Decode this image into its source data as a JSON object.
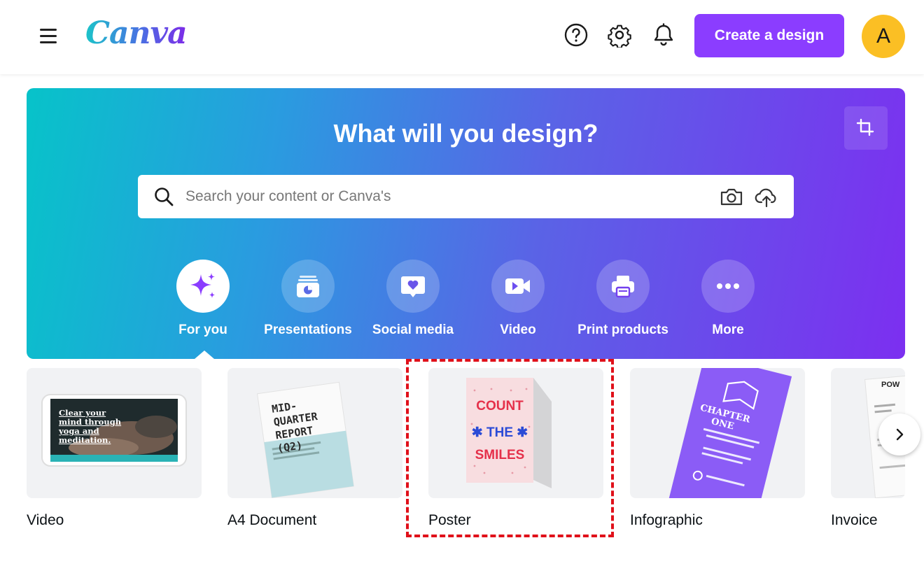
{
  "header": {
    "logo_text": "Canva",
    "create_label": "Create a design",
    "avatar_initial": "A"
  },
  "hero": {
    "title": "What will you design?",
    "search_placeholder": "Search your content or Canva's",
    "categories": [
      {
        "label": "For you",
        "icon": "sparkle-icon",
        "active": true
      },
      {
        "label": "Presentations",
        "icon": "presentation-icon"
      },
      {
        "label": "Social media",
        "icon": "heart-chat-icon"
      },
      {
        "label": "Video",
        "icon": "video-camera-icon"
      },
      {
        "label": "Print products",
        "icon": "printer-icon"
      },
      {
        "label": "More",
        "icon": "more-dots-icon"
      }
    ]
  },
  "templates": [
    {
      "label": "Video",
      "thumb_text": "Clear your mind through yoga and meditation."
    },
    {
      "label": "A4 Document",
      "thumb_text": "MID-QUARTER REPORT (Q2)"
    },
    {
      "label": "Poster",
      "thumb_text": "COUNT THE SMILES"
    },
    {
      "label": "Infographic",
      "thumb_text": "CHAPTER ONE"
    },
    {
      "label": "Invoice",
      "thumb_text": "POW"
    }
  ],
  "colors": {
    "brand_purple": "#8b3dff",
    "avatar_yellow": "#fbbf24",
    "highlight_red": "#e0101a"
  }
}
